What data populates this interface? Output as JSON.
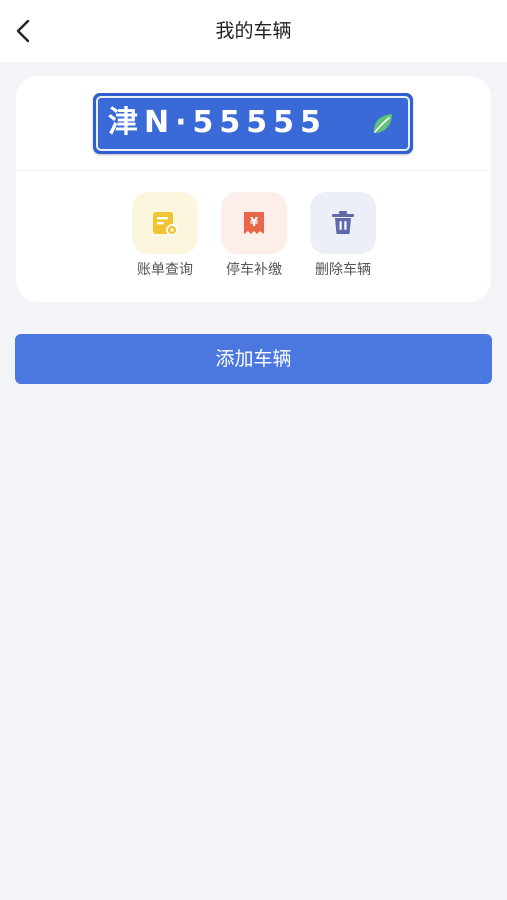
{
  "header": {
    "title": "我的车辆",
    "back_icon": "chevron-left-icon"
  },
  "vehicle": {
    "plate_number": "津N·55555",
    "plate_color": "#3a69d8",
    "new_energy_icon": "leaf-icon"
  },
  "actions": [
    {
      "label": "账单查询",
      "icon": "bill-icon",
      "tile_color": "#fdf6df",
      "icon_color": "#f0c433"
    },
    {
      "label": "停车补缴",
      "icon": "yuan-receipt-icon",
      "tile_color": "#fdeeea",
      "icon_color": "#e8664a"
    },
    {
      "label": "删除车辆",
      "icon": "trash-icon",
      "tile_color": "#eceef8",
      "icon_color": "#5e6aaa"
    }
  ],
  "add_button": {
    "label": "添加车辆",
    "color": "#4a78e0"
  }
}
